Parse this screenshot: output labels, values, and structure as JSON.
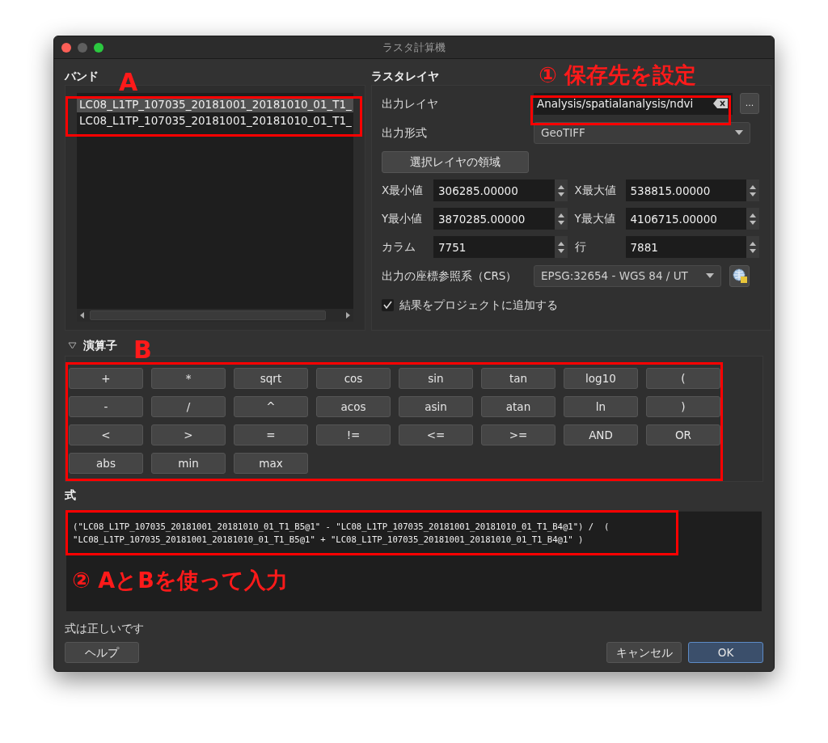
{
  "window": {
    "title": "ラスタ計算機"
  },
  "bands": {
    "title": "バンド",
    "items": [
      {
        "label": "LC08_L1TP_107035_20181001_20181010_01_T1_",
        "selected": true
      },
      {
        "label": "LC08_L1TP_107035_20181001_20181010_01_T1_",
        "selected": false
      }
    ]
  },
  "raster_layer": {
    "title": "ラスタレイヤ",
    "output_layer": {
      "label": "出力レイヤ",
      "value": "Analysis/spatialanalysis/ndvi",
      "browse": "..."
    },
    "output_format": {
      "label": "出力形式",
      "value": "GeoTIFF"
    },
    "extent_button": "選択レイヤの領域",
    "fields": [
      {
        "label": "X最小値",
        "value": "306285.00000"
      },
      {
        "label": "X最大値",
        "value": "538815.00000"
      },
      {
        "label": "Y最小値",
        "value": "3870285.00000"
      },
      {
        "label": "Y最大値",
        "value": "4106715.00000"
      },
      {
        "label": "カラム",
        "value": "7751"
      },
      {
        "label": "行",
        "value": "7881"
      }
    ],
    "crs": {
      "label": "出力の座標参照系（CRS）",
      "value": "EPSG:32654 - WGS 84 / UT"
    },
    "add_to_project": {
      "label": "結果をプロジェクトに追加する",
      "checked": true
    }
  },
  "operators": {
    "title": "演算子",
    "expanded": true,
    "buttons": [
      "+",
      "*",
      "sqrt",
      "cos",
      "sin",
      "tan",
      "log10",
      "(",
      "-",
      "/",
      "^",
      "acos",
      "asin",
      "atan",
      "ln",
      ")",
      "<",
      ">",
      "=",
      "!=",
      "<=",
      ">=",
      "AND",
      "OR",
      "abs",
      "min",
      "max"
    ]
  },
  "expression": {
    "title": "式",
    "lines": [
      "(\"LC08_L1TP_107035_20181001_20181010_01_T1_B5@1\" - \"LC08_L1TP_107035_20181001_20181010_01_T1_B4@1\") /  (",
      "\"LC08_L1TP_107035_20181001_20181010_01_T1_B5@1\" + \"LC08_L1TP_107035_20181001_20181010_01_T1_B4@1\" )"
    ],
    "status": "式は正しいです"
  },
  "buttons": [
    {
      "label": "ヘルプ",
      "default": false
    },
    {
      "label": "キャンセル",
      "default": false
    },
    {
      "label": "OK",
      "default": true
    }
  ],
  "annotations": [
    "A",
    "B",
    "① 保存先を設定",
    "② AとBを使って入力"
  ]
}
